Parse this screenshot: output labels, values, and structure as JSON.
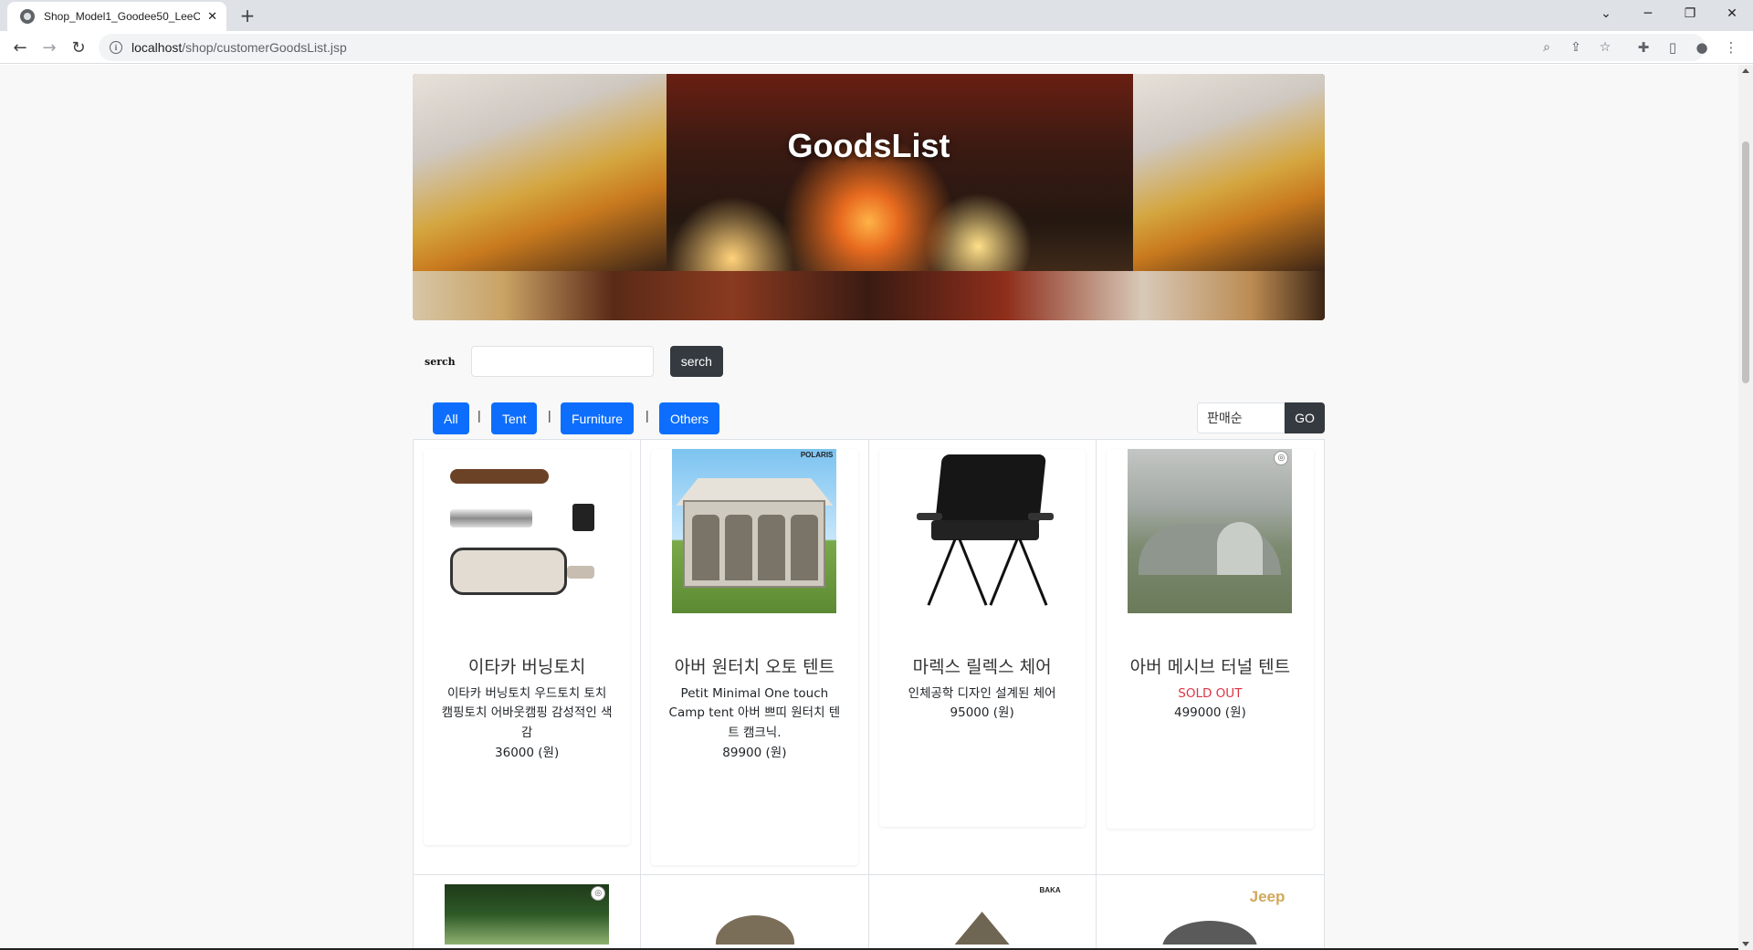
{
  "browser": {
    "tab_title": "Shop_Model1_Goodee50_LeeCh",
    "url_host": "localhost",
    "url_path": "/shop/customerGoodsList.jsp",
    "new_tab_symbol": "+",
    "close_symbol": "✕"
  },
  "banner": {
    "title": "GoodsList"
  },
  "search": {
    "label": "serch",
    "input_value": "",
    "button_label": "serch"
  },
  "categories": [
    {
      "label": "All"
    },
    {
      "label": "Tent"
    },
    {
      "label": "Furniture"
    },
    {
      "label": "Others"
    }
  ],
  "separator": "|",
  "sort": {
    "selected": "판매순",
    "go_label": "GO"
  },
  "goods": [
    {
      "name": "이타카 버닝토치",
      "desc": "이타카 버닝토치 우드토치 토치 캠핑토치 어바웃캠핑 감성적인 색감",
      "status": "",
      "price": "36000 (원)"
    },
    {
      "name": "아버 원터치 오토 텐트",
      "desc": "Petit Minimal One touch Camp tent 아버 쁘띠 원터치 텐트 캠크닉.",
      "status": "",
      "price": "89900 (원)",
      "brand_tag": "POLARIS"
    },
    {
      "name": "마렉스 릴렉스 체어",
      "desc": "인체공학 디자인 설계된 체어",
      "status": "",
      "price": "95000 (원)"
    },
    {
      "name": "아버 메시브 터널 텐트",
      "desc": "",
      "status": "SOLD OUT",
      "price": "499000 (원)"
    }
  ],
  "row2_tags": {
    "jeep": "Jeep",
    "brand2": "BAKA"
  },
  "colors": {
    "primary": "#0d6efd",
    "dark": "#343a40",
    "soldout": "#dc3545"
  }
}
